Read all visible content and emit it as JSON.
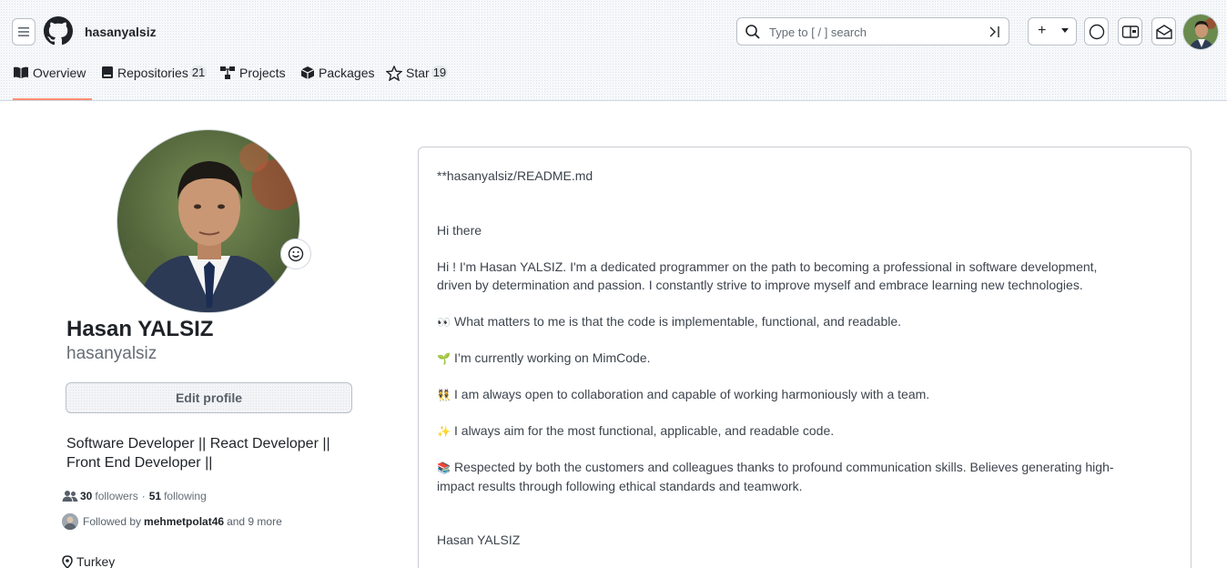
{
  "header": {
    "username": "hasanyalsiz",
    "search_placeholder": "Type to [ / ] search",
    "new_label": "+"
  },
  "tabs": [
    {
      "label": "Overview",
      "count": ""
    },
    {
      "label": "Repositories",
      "count": "21"
    },
    {
      "label": "Projects",
      "count": ""
    },
    {
      "label": "Packages",
      "count": ""
    },
    {
      "label": "Star",
      "count": "19"
    }
  ],
  "profile": {
    "name": "Hasan YALSIZ",
    "login": "hasanyalsiz",
    "edit_label": "Edit profile",
    "bio_line1": "Software Developer || React Developer ||",
    "bio_line2": "Front End Developer ||",
    "followers_count": "30",
    "followers_label": "followers",
    "separator": "·",
    "following_count": "51",
    "following_label": "following",
    "followed_by_prefix": "Followed by",
    "followed_by_user": "mehmetpolat46",
    "followed_by_suffix": "and 9 more",
    "location": "Turkey"
  },
  "readme": {
    "title": "**hasanyalsiz/README.md",
    "greeting": "Hi there",
    "intro": "Hi ! I'm Hasan YALSIZ. I'm a dedicated programmer on the path to becoming a professional in software development,",
    "intro2": "driven by determination and passion. I constantly strive to improve myself and embrace learning new technologies.",
    "point1": "What matters to me is that the code is implementable, functional, and readable.",
    "point2": "I’m currently working on MimCode.",
    "point3": "I am always open to collaboration and capable of working harmoniously with a team.",
    "point4": "I always aim for the most functional, applicable, and readable code.",
    "point5": "Respected by both the customers and colleagues thanks to profound communication skills. Believes generating high-",
    "point5b": "impact results through following ethical standards and teamwork.",
    "signature": "Hasan YALSIZ",
    "emoji1": "👀",
    "emoji2": "🌱",
    "emoji3": "👯",
    "emoji4": "✨",
    "emoji5": "📚"
  },
  "icons": {
    "status": "smiley-icon"
  }
}
